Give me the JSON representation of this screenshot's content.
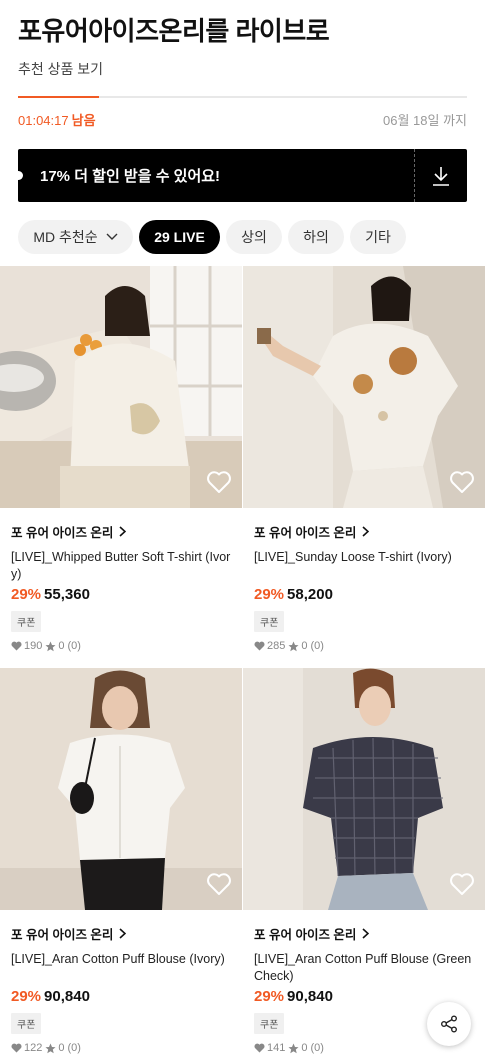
{
  "header": {
    "title": "포유어아이즈온리를 라이브로",
    "subtitle": "추천 상품 보기"
  },
  "timer": {
    "time": "01:04:17",
    "remain_label": "남음",
    "deadline": "06월 18일 까지",
    "progress_fraction": 0.18
  },
  "coupon": {
    "text": "17% 더 할인 받을 수 있어요!",
    "download_icon": "download-icon"
  },
  "chips": [
    {
      "label": "MD 추천순",
      "active": false
    },
    {
      "label": "29 LIVE",
      "active": true
    },
    {
      "label": "상의",
      "active": false
    },
    {
      "label": "하의",
      "active": false
    },
    {
      "label": "기타",
      "active": false
    }
  ],
  "products": [
    {
      "brand": "포 유어 아이즈 온리",
      "name": "[LIVE]_Whipped Butter Soft T-shirt (Ivory)",
      "discount": "29%",
      "price": "55,360",
      "coupon": "쿠폰",
      "likes": "190",
      "rating": "0",
      "reviews": "(0)"
    },
    {
      "brand": "포 유어 아이즈 온리",
      "name": "[LIVE]_Sunday Loose T-shirt (Ivory)",
      "discount": "29%",
      "price": "58,200",
      "coupon": "쿠폰",
      "likes": "285",
      "rating": "0",
      "reviews": "(0)"
    },
    {
      "brand": "포 유어 아이즈 온리",
      "name": "[LIVE]_Aran Cotton Puff Blouse (Ivory)",
      "discount": "29%",
      "price": "90,840",
      "coupon": "쿠폰",
      "likes": "122",
      "rating": "0",
      "reviews": "(0)"
    },
    {
      "brand": "포 유어 아이즈 온리",
      "name": "[LIVE]_Aran Cotton Puff Blouse (Green Check)",
      "discount": "29%",
      "price": "90,840",
      "coupon": "쿠폰",
      "likes": "141",
      "rating": "0",
      "reviews": "(0)"
    }
  ],
  "colors": {
    "accent": "#f15a24",
    "coupon_bg": "#000000"
  }
}
